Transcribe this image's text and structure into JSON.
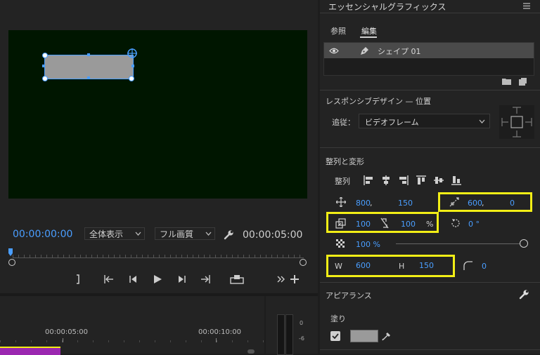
{
  "program_monitor": {
    "timecode_current": "00:00:00:00",
    "fit_select": "全体表示",
    "quality_select": "フル画質",
    "timecode_duration": "00:00:05:00"
  },
  "timeline": {
    "ruler_labels": [
      "00:00:05:00",
      "00:00:10:00"
    ],
    "meter_labels": [
      "0",
      "-6"
    ]
  },
  "essential_graphics": {
    "title": "エッセンシャルグラフィックス",
    "tabs": [
      "参照",
      "編集"
    ],
    "layer_name": "シェイプ 01",
    "responsive": {
      "heading": "レスポンシブデザイン — 位置",
      "follow_label": "追従：",
      "follow_value": "ビデオフレーム"
    },
    "align": {
      "heading": "整列と変形",
      "align_label": "整列",
      "position_x": "800",
      "position_comma": ",",
      "position_y": "150",
      "anchor_x": "600",
      "anchor_comma": ",",
      "anchor_y": "0",
      "scale_w": "100",
      "scale_h": "100",
      "scale_unit": "%",
      "rotation": "0 °",
      "opacity": "100 %",
      "width_label": "W",
      "width_value": "600",
      "height_label": "H",
      "height_value": "150",
      "corner_radius": "0",
      "opacity_level": 1.0
    },
    "appearance": {
      "heading": "アピアランス",
      "fill_label": "塗り",
      "fill_checked": true,
      "fill_color": "#9a9a9a"
    }
  },
  "colors": {
    "accent": "#4a9eff",
    "highlight": "#f2ee16",
    "canvas": "#001600",
    "clip": "#9b27b0"
  }
}
